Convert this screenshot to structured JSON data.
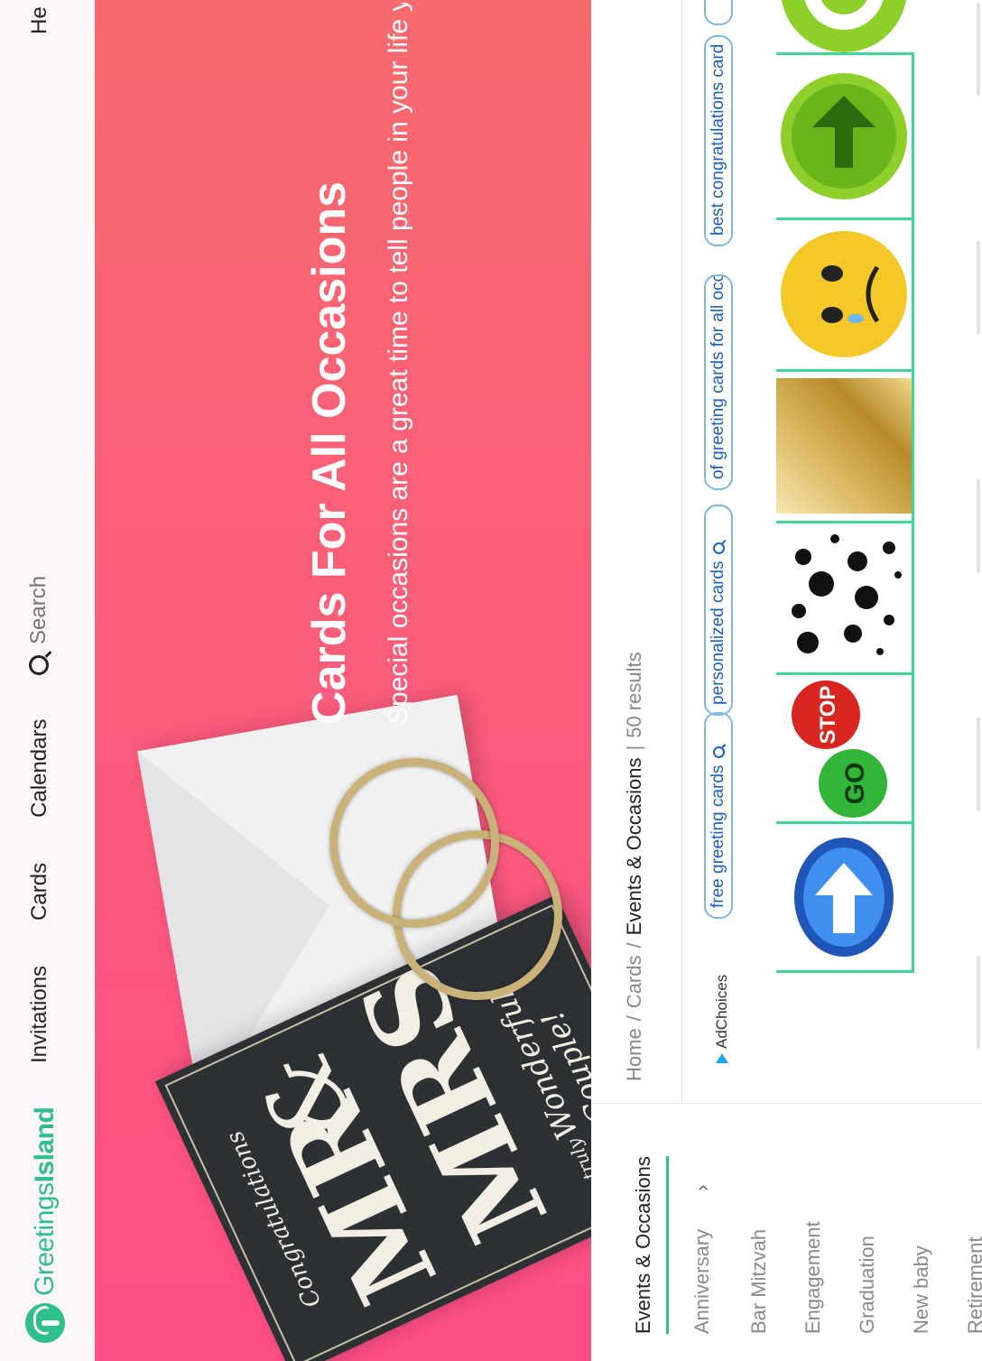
{
  "nav": {
    "logo_regular": "Greetings",
    "logo_bold": "Island",
    "links": [
      "Invitations",
      "Cards",
      "Calendars"
    ],
    "search_placeholder": "Search",
    "help_label": "He"
  },
  "hero": {
    "title": "Cards For All Occasions",
    "subtitle": "Special occasions are a great time to tell people in your life you c",
    "card_top": "Congratulations",
    "card_mr": "MR",
    "card_amp": "&",
    "card_mrs": "MRS",
    "card_truly": "a truly",
    "card_wonderful": "Wonderful Couple!"
  },
  "sidebar": {
    "heading": "Events & Occasions",
    "items": [
      "Anniversary",
      "Bar Mitzvah",
      "Engagement",
      "Graduation",
      "New baby",
      "Retirement"
    ],
    "expand_glyph": "›"
  },
  "breadcrumb": {
    "home": "Home",
    "cards": "Cards",
    "current": "Events & Occasions",
    "results": "50 results"
  },
  "ads": {
    "adchoices_label": "AdChoices",
    "pills": [
      "free greeting cards",
      "personalized cards",
      "of greeting cards for all occ",
      "best congratulations card"
    ],
    "go_label": "GO",
    "stop_label": "STOP"
  },
  "colors": {
    "brand_green": "#2fc08a",
    "hero_left": "#ff4f86",
    "hero_right": "#f76a6e",
    "ad_border": "#3fd69a",
    "ad_link": "#1a5fc4"
  }
}
